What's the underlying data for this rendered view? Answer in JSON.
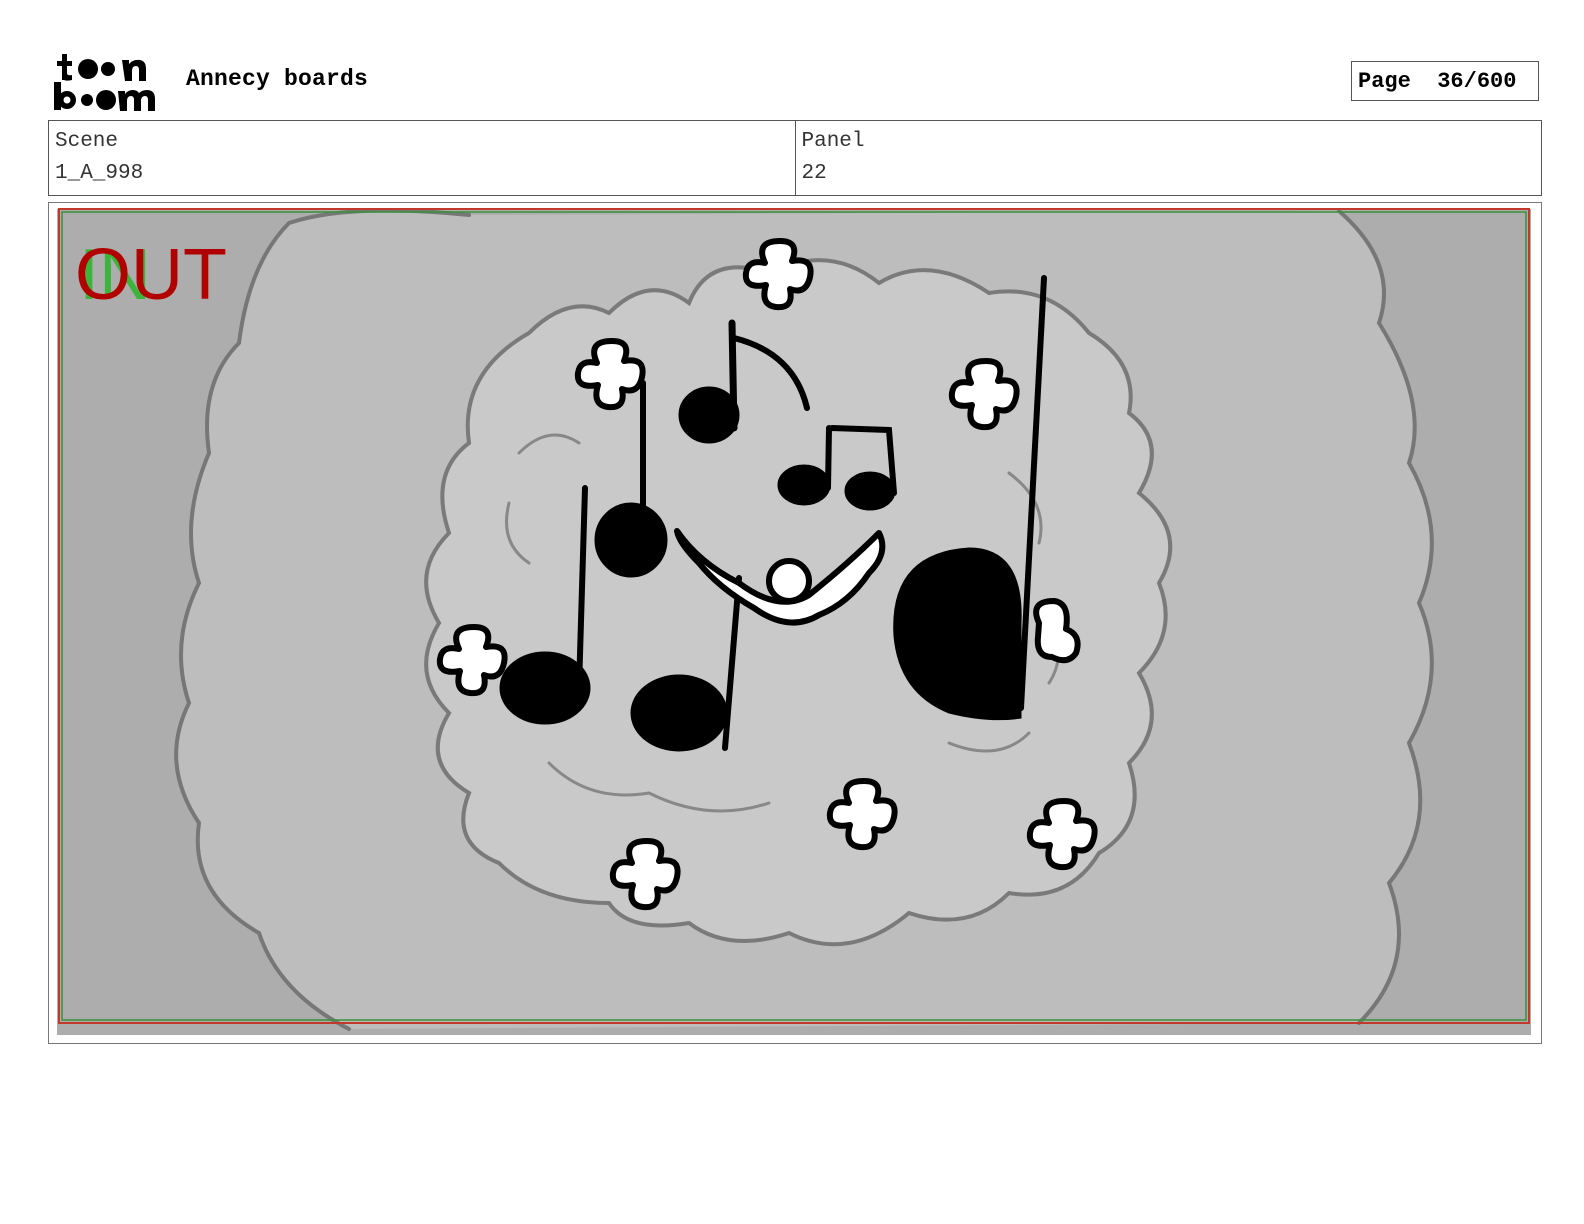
{
  "header": {
    "logo_text_top": "toon",
    "logo_text_bottom": "boom",
    "project_title": "Annecy boards",
    "page_label": "Page",
    "page_value": "36/600"
  },
  "info": {
    "scene_label": "Scene",
    "scene_value": "1_A_998",
    "panel_label": "Panel",
    "panel_value": "22"
  },
  "panel": {
    "in_marker": "IN",
    "out_marker": "OUT",
    "colors": {
      "in": "#2fb52f",
      "out": "#b00000",
      "border_red": "#c0392b",
      "border_green": "#3a8f3a"
    }
  }
}
